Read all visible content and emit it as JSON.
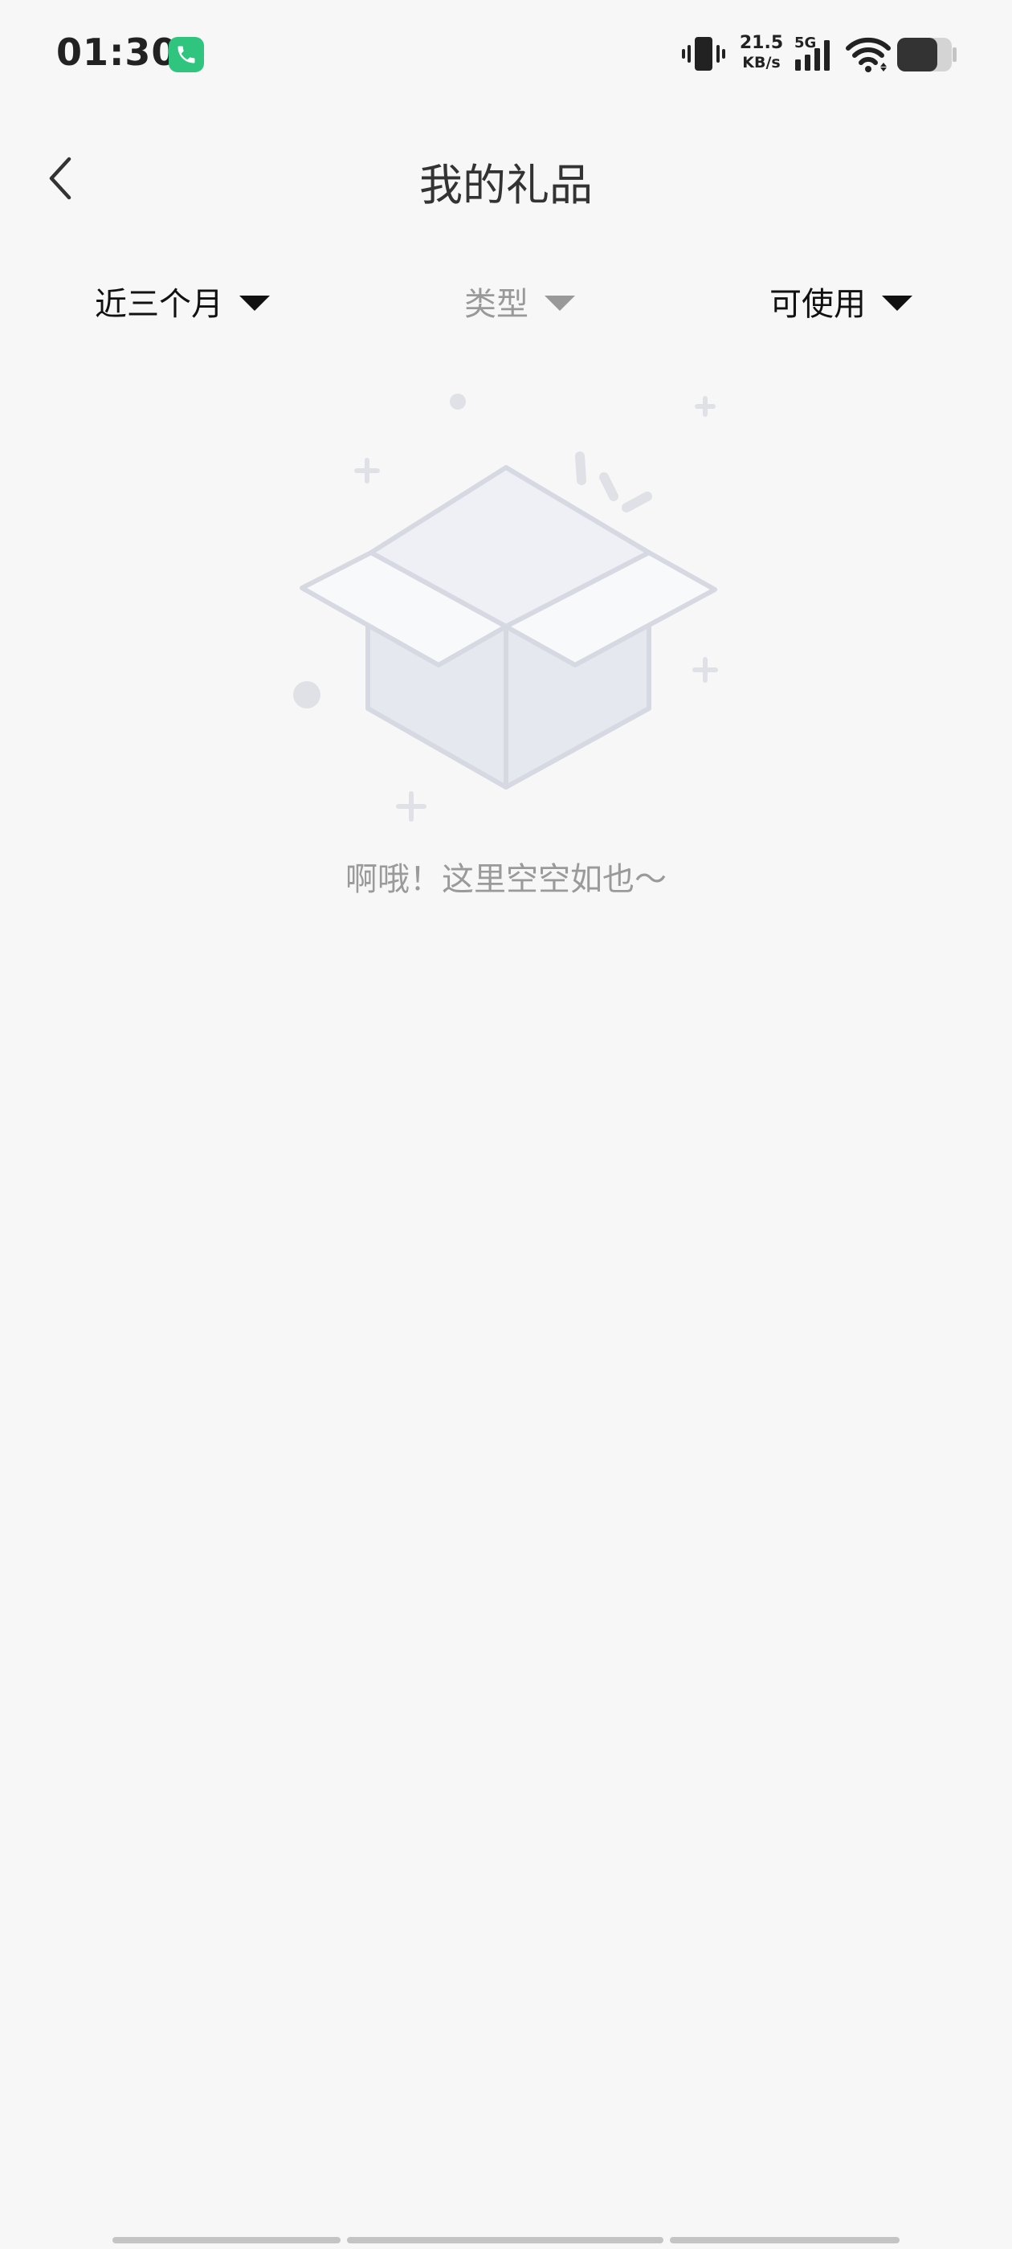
{
  "status_bar": {
    "time": "01:30",
    "call_icon": "phone-call-icon",
    "accent_color": "#2fc57e",
    "net_speed_value": "21.5",
    "net_speed_unit": "KB/s",
    "network_type": "5G"
  },
  "header": {
    "back_icon": "chevron-left-icon",
    "title": "我的礼品"
  },
  "filters": {
    "period": "近三个月",
    "type": "类型",
    "status": "可使用"
  },
  "empty_state": {
    "illustration": "open-box-icon",
    "message": "啊哦！这里空空如也～"
  }
}
